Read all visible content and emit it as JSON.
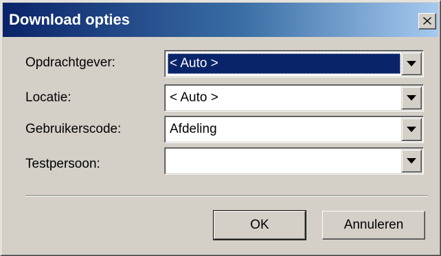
{
  "window": {
    "title": "Download opties",
    "close_icon": "close-x-icon"
  },
  "fields": [
    {
      "label": "Opdrachtgever:",
      "value": "< Auto >",
      "selected": true
    },
    {
      "label": "Locatie:",
      "value": "< Auto >",
      "selected": false
    },
    {
      "label": "Gebruikerscode:",
      "value": "Afdeling",
      "selected": false
    },
    {
      "label": "Testpersoon:",
      "value": "",
      "selected": false
    }
  ],
  "buttons": {
    "ok_label": "OK",
    "cancel_label": "Annuleren"
  },
  "colors": {
    "titlebar_start": "#0a246a",
    "titlebar_end": "#a6caf0",
    "dialog_face": "#d4d0c8",
    "selection": "#0a246a"
  }
}
